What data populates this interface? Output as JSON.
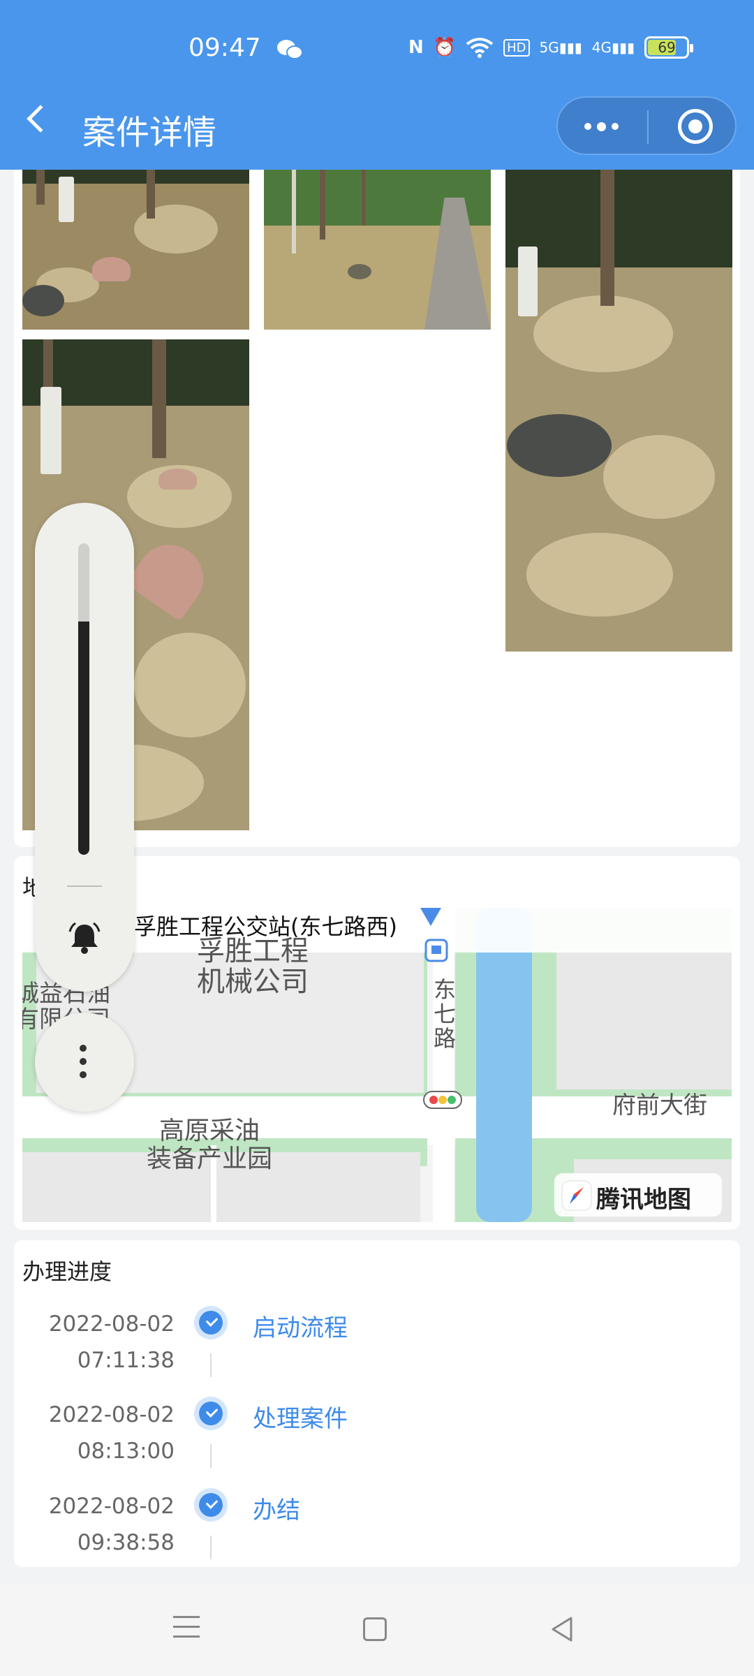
{
  "status_bar": {
    "time": "09:47",
    "icons": [
      "wechat-icon",
      "nfc-icon",
      "alarm-icon",
      "wifi-icon",
      "hd-icon",
      "5g-signal-icon",
      "4g-signal-icon"
    ],
    "battery": "69"
  },
  "header": {
    "title": "案件详情",
    "back_icon": "chevron-left-icon",
    "menu_icon": "more-dots-icon",
    "close_icon": "target-icon"
  },
  "map_section": {
    "title_partial": "地",
    "location": "孚胜工程公交站(东七路西)",
    "labels": {
      "company": "孚胜工程\n机械公司",
      "left_company": "诚益石油\n有限公司",
      "road_vertical": "东\n七\n路",
      "road_horizontal": "府前大街",
      "park": "高原采油\n装备产业园",
      "brand": "腾讯地图"
    }
  },
  "progress": {
    "title": "办理进度",
    "steps": [
      {
        "date": "2022-08-02",
        "time": "07:11:38",
        "label": "启动流程"
      },
      {
        "date": "2022-08-02",
        "time": "08:13:00",
        "label": "处理案件"
      },
      {
        "date": "2022-08-02",
        "time": "09:38:58",
        "label": "办结"
      }
    ]
  },
  "volume": {
    "level": 0.75
  },
  "colors": {
    "brand": "#4a96ec",
    "accent": "#3e8bea"
  }
}
